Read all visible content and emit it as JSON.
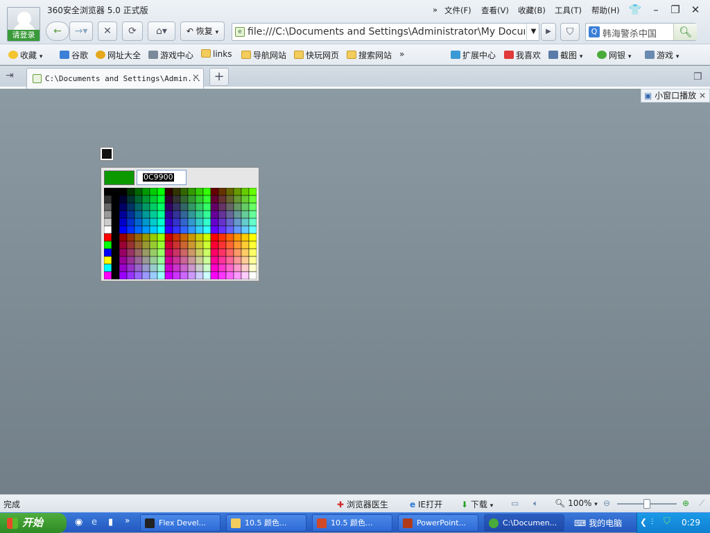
{
  "window": {
    "title": "360安全浏览器 5.0 正式版",
    "login_label": "请登录",
    "menu": [
      "文件(F)",
      "查看(V)",
      "收藏(B)",
      "工具(T)",
      "帮助(H)"
    ],
    "more_symbol": "»"
  },
  "toolbar": {
    "restore_label": "恢复",
    "address": "file:///C:\\Documents and Settings\\Administrator\\My Documents",
    "search_placeholder": "韩海警杀中国"
  },
  "bookmarks": {
    "favorites_label": "收藏",
    "items": [
      "谷歌",
      "网址大全",
      "游戏中心",
      "links",
      "导航网站",
      "快玩网页",
      "搜索网站"
    ],
    "right_items": [
      "扩展中心",
      "我喜欢",
      "截图",
      "网银",
      "游戏"
    ]
  },
  "tab": {
    "title": "C:\\Documents and Settings\\Admin...",
    "close_symbol": "✕",
    "new_symbol": "+"
  },
  "content": {
    "mini_player_label": "小窗口播放",
    "selected_color": "#0C9900",
    "hex_value": "0C9900"
  },
  "status": {
    "text": "完成",
    "doctor_label": "浏览器医生",
    "ie_label": "IE打开",
    "download_label": "下载",
    "zoom_label": "100%"
  },
  "taskbar": {
    "start_label": "开始",
    "tasks": [
      "Flex Devel...",
      "10.5 颜色...",
      "10.5 颜色...",
      "PowerPoint...",
      "C:\\Documen..."
    ],
    "computer_label": "我的电脑",
    "clock": "0:29"
  }
}
